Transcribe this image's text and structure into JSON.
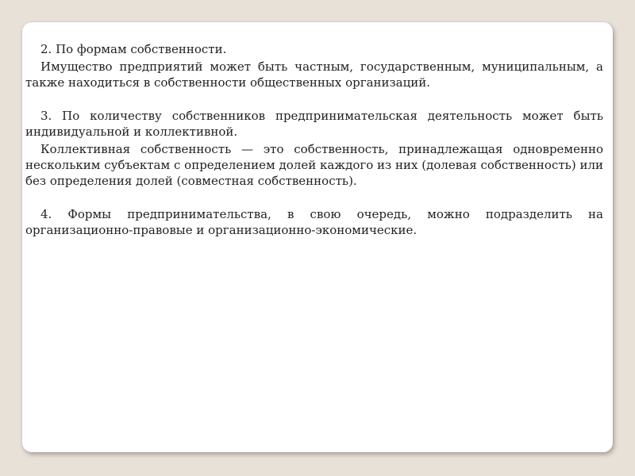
{
  "slide": {
    "paragraphs": [
      "2. По формам собственности.",
      "Имущество предприятий может быть частным, государственным, муниципальным, а также находиться в собственности общественных организаций.",
      "3. По количеству собственников предпринимательская деятельность может быть индивидуальной и коллективной.",
      "Коллективная собственность — это собственность, принадлежащая одновременно нескольким субъектам с определением долей каждого из них (долевая собственность) или без определения долей (совместная собственность).",
      "4. Формы предпринимательства, в свою очередь, можно подразделить на организационно-правовые и организационно-экономические."
    ]
  }
}
